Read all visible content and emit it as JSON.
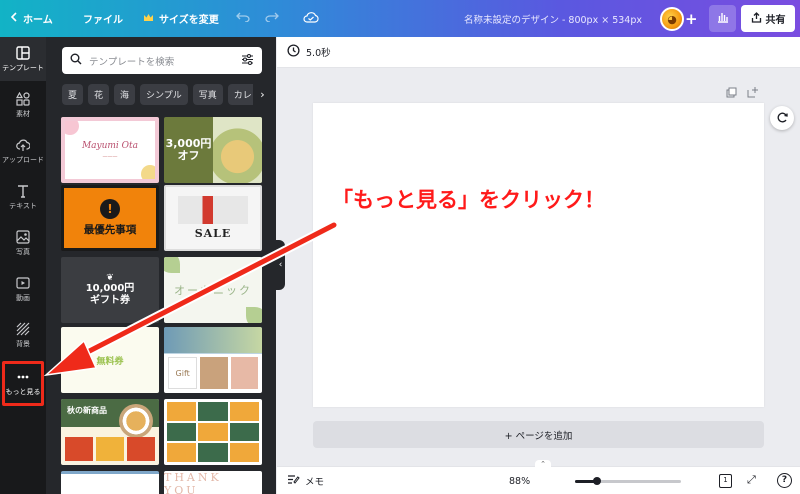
{
  "topbar": {
    "home_label": "ホーム",
    "file_label": "ファイル",
    "resize_label": "サイズを変更",
    "doc_title": "名称未設定のデザイン - 800px × 534px",
    "share_label": "共有"
  },
  "sidebar": {
    "items": [
      {
        "label": "テンプレート",
        "icon": "template-icon"
      },
      {
        "label": "素材",
        "icon": "elements-icon"
      },
      {
        "label": "アップロード",
        "icon": "upload-icon"
      },
      {
        "label": "テキスト",
        "icon": "text-icon"
      },
      {
        "label": "写真",
        "icon": "photo-icon"
      },
      {
        "label": "動画",
        "icon": "video-icon"
      },
      {
        "label": "背景",
        "icon": "background-icon"
      },
      {
        "label": "もっと見る",
        "icon": "more-icon"
      }
    ]
  },
  "panel": {
    "search_placeholder": "テンプレートを検索",
    "chips": [
      "夏",
      "花",
      "海",
      "シンプル",
      "写真",
      "カレンダー"
    ],
    "thumbs": {
      "t1_name": "Mayumi Ota",
      "t2_price": "3,000円",
      "t2_off": "オフ",
      "t3_text": "最優先事項",
      "t4_text": "SALE",
      "t5_price": "10,000円",
      "t5_label": "ギフト券",
      "t6_text": "オーガニック",
      "t7_text": "無料券",
      "t8_text": "Gift",
      "t9_text": "秋の新商品",
      "t12_text": "THANK YOU"
    }
  },
  "editor": {
    "duration": "5.0秒",
    "add_page_label": "+ ページを追加",
    "annotation": "「もっと見る」をクリック！"
  },
  "bottombar": {
    "notes_label": "メモ",
    "zoom": "88%",
    "zoom_fraction": 0.2,
    "page_count": "1"
  },
  "colors": {
    "accent_gradient_start": "#12b3c6",
    "accent_gradient_end": "#7a4de0",
    "highlight_red": "#ef2a1a",
    "rail_bg": "#18191b",
    "panel_bg": "#25272b"
  }
}
